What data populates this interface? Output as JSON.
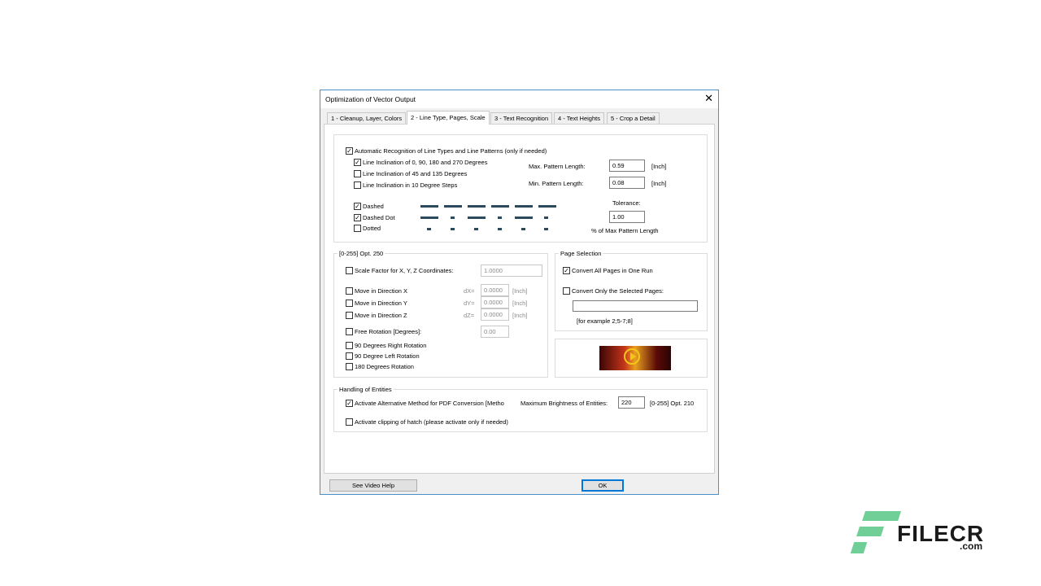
{
  "window": {
    "title": "Optimization of Vector Output",
    "close": "✕"
  },
  "tabs": [
    {
      "label": "1 - Cleanup, Layer, Colors"
    },
    {
      "label": "2 - Line Type, Pages, Scale"
    },
    {
      "label": "3 - Text Recognition"
    },
    {
      "label": "4 - Text Heights"
    },
    {
      "label": "5 - Crop a Detail"
    }
  ],
  "line_types": {
    "auto": {
      "label": "Automatic Recognition of Line Types and Line Patterns (only if needed)",
      "checked": true
    },
    "incl_0_90": {
      "label": "Line Inclination of 0, 90, 180 and 270 Degrees",
      "checked": true
    },
    "incl_45": {
      "label": "Line Inclination of 45 and 135 Degrees",
      "checked": false
    },
    "incl_10": {
      "label": "Line Inclination in 10 Degree Steps",
      "checked": false
    },
    "max_pattern_label": "Max. Pattern Length:",
    "max_pattern_value": "0.59",
    "min_pattern_label": "Min. Pattern Length:",
    "min_pattern_value": "0.08",
    "unit": "[Inch]",
    "dashed": {
      "label": "Dashed",
      "checked": true
    },
    "dashed_dot": {
      "label": "Dashed Dot",
      "checked": true
    },
    "dotted": {
      "label": "Dotted",
      "checked": false
    },
    "tolerance_label": "Tolerance:",
    "tolerance_value": "1.00",
    "tolerance_note": "% of Max Pattern Length"
  },
  "scale": {
    "group_label": "[0-255] Opt. 250",
    "scale_factor": {
      "label": "Scale Factor for X, Y, Z Coordinates:",
      "checked": false,
      "value": "1.0000"
    },
    "move_x": {
      "label": "Move in Direction X",
      "checked": false,
      "prefix": "dX=",
      "value": "0.0000"
    },
    "move_y": {
      "label": "Move in Direction Y",
      "checked": false,
      "prefix": "dY=",
      "value": "0.0000"
    },
    "move_z": {
      "label": "Move in Direction Z",
      "checked": false,
      "prefix": "dZ=",
      "value": "0.0000"
    },
    "unit": "[Inch]",
    "free_rotation": {
      "label": "Free Rotation [Degrees]:",
      "checked": false,
      "value": "0.00"
    },
    "rot_90_right": {
      "label": "90 Degrees Right Rotation",
      "checked": false
    },
    "rot_90_left": {
      "label": "90 Degree Left Rotation",
      "checked": false
    },
    "rot_180": {
      "label": "180 Degrees Rotation",
      "checked": false
    }
  },
  "pages": {
    "group_label": "Page Selection",
    "convert_all": {
      "label": "Convert All Pages in One Run",
      "checked": true
    },
    "convert_selected": {
      "label": "Convert Only the Selected Pages:",
      "checked": false
    },
    "pages_value": "",
    "example": "[for example 2;5-7;8]"
  },
  "entities": {
    "group_label": "Handling of Entities",
    "alt_method": {
      "label": "Activate Alternative Method for PDF Conversion [Metho",
      "checked": true
    },
    "max_brightness_label": "Maximum Brightness of Entities:",
    "max_brightness_value": "220",
    "max_brightness_hint": "[0-255] Opt. 210",
    "clipping": {
      "label": "Activate clipping of hatch (please activate only if needed)",
      "checked": false
    }
  },
  "footer": {
    "video_help": "See Video Help",
    "ok": "OK"
  },
  "watermark": {
    "brand": "FILECR",
    "suffix": ".com"
  },
  "colors": {
    "accent": "#0078d7",
    "dash": "#2c4a5e",
    "watermark": "#6fcf97"
  }
}
